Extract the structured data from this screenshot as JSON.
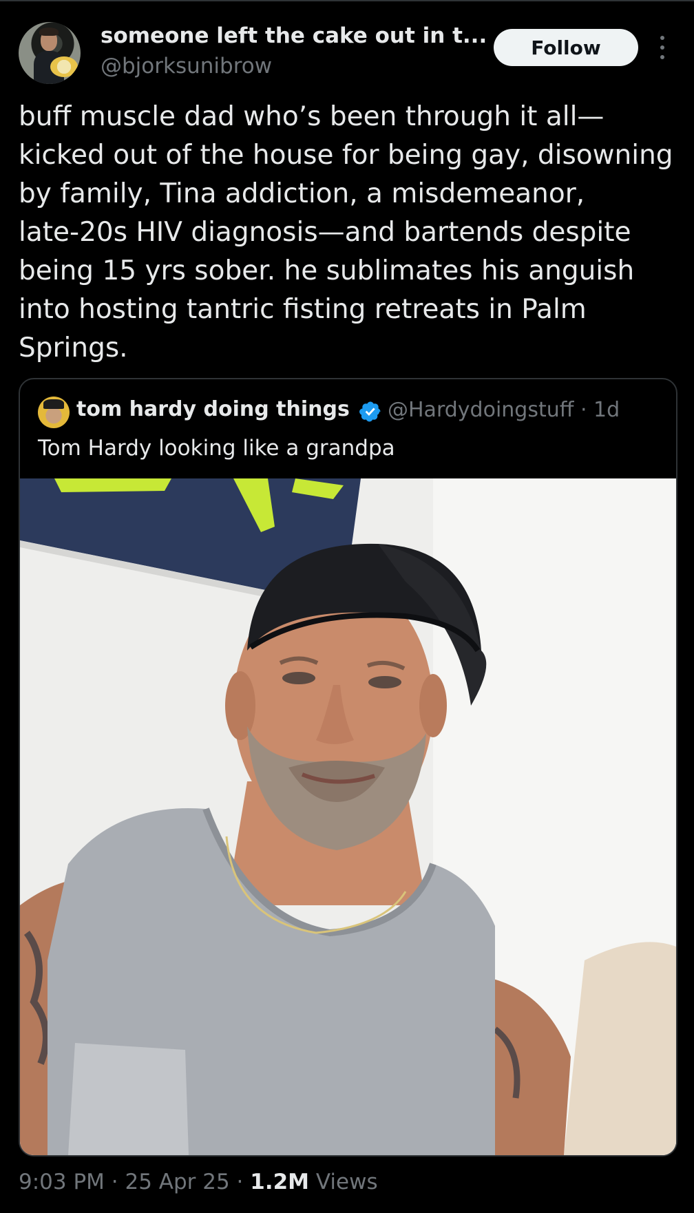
{
  "author": {
    "display_name": "someone left the cake out in t...",
    "handle": "@bjorksunibrow"
  },
  "follow_label": "Follow",
  "tweet": {
    "lines": [
      "buff muscle dad who’s been through it all—",
      "kicked out of the house for being gay, disowning",
      "by family, Tina addiction, a misdemeanor,",
      "late-20s HIV diagnosis—and bartends despite",
      "being 15 yrs sober. he sublimates his anguish",
      "into hosting tantric fisting retreats in Palm",
      "Springs."
    ]
  },
  "quoted": {
    "display_name": "tom hardy doing things",
    "handle_time": "@Hardydoingstuff · 1d",
    "text": "Tom Hardy looking like a grandpa",
    "verified_color": "#1d9bf0"
  },
  "meta": {
    "time_date": "9:03 PM · 25 Apr 25 · ",
    "views_count": "1.2M",
    "views_label": " Views"
  },
  "icons": {
    "more": "more-vertical-icon",
    "verified": "verified-badge-icon"
  },
  "colors": {
    "background": "#000000",
    "text": "#e7e9ea",
    "muted": "#71767b",
    "border": "#2f3336",
    "follow_bg": "#eff3f4"
  }
}
